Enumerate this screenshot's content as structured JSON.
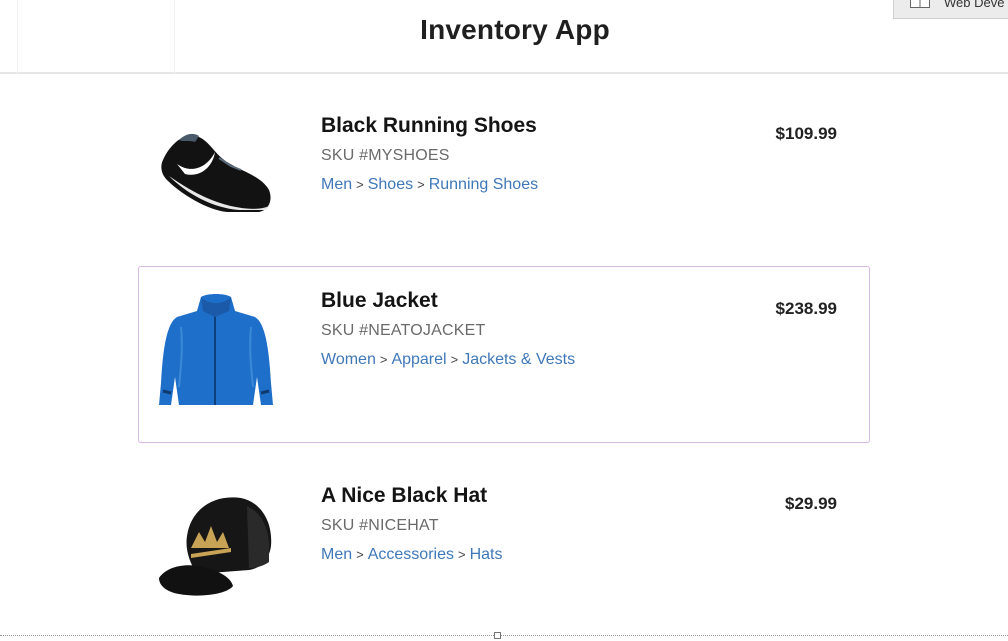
{
  "app": {
    "title": "Inventory App"
  },
  "browser_tab": {
    "label": "Web Deve"
  },
  "products": [
    {
      "name": "Black Running Shoes",
      "sku": "SKU #MYSHOES",
      "categories": [
        "Men",
        "Shoes",
        "Running Shoes"
      ],
      "price": "$109.99",
      "image_icon": "shoe-image"
    },
    {
      "name": "Blue Jacket",
      "sku": "SKU #NEATOJACKET",
      "categories": [
        "Women",
        "Apparel",
        "Jackets & Vests"
      ],
      "price": "$238.99",
      "image_icon": "jacket-image",
      "selected": true
    },
    {
      "name": "A Nice Black Hat",
      "sku": "SKU #NICEHAT",
      "categories": [
        "Men",
        "Accessories",
        "Hats"
      ],
      "price": "$29.99",
      "image_icon": "hat-image"
    }
  ],
  "breadcrumb_separator": ">",
  "colors": {
    "link": "#3f78b8",
    "selected_border": "#d7b8df",
    "title": "#1f1f1f"
  }
}
